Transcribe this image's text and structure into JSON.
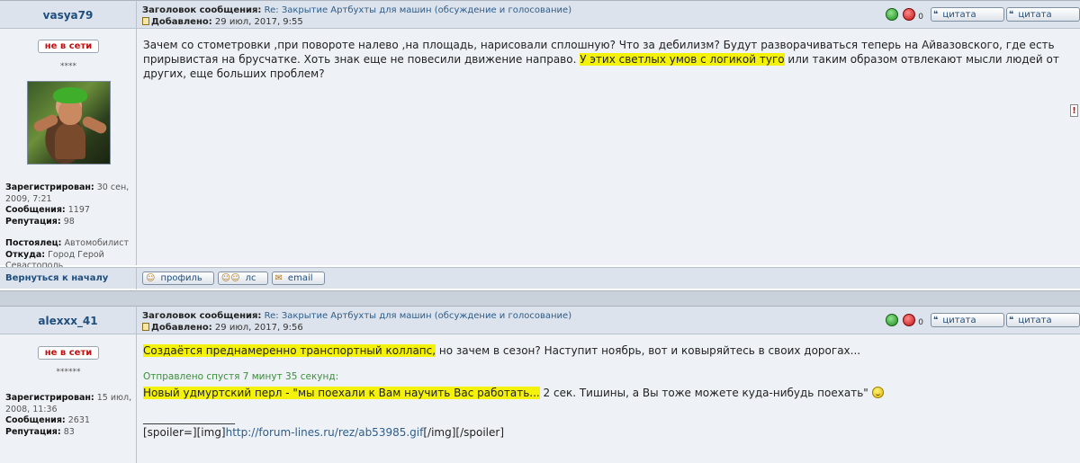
{
  "posts": [
    {
      "author": "vasya79",
      "subject_label": "Заголовок сообщения:",
      "subject": "Re: Закрытие Артбухты для машин (обсуждение и голосование)",
      "date_label": "Добавлено:",
      "date": "29 июл, 2017, 9:55",
      "karma": "0",
      "status": "не в сети",
      "stars": "****",
      "profile": {
        "registered_label": "Зарегистрирован:",
        "registered_line1": "30 сен,",
        "registered_line2": "2009, 7:21",
        "posts_label": "Сообщения:",
        "posts": "1197",
        "rep_label": "Репутация:",
        "rep": "98",
        "resident_label": "Постоялец:",
        "resident": "Автомобилист",
        "from_label": "Откуда:",
        "from_line1": "Город Герой",
        "from_line2": "Севастополь"
      },
      "message_part1": "Зачем со стометровки ,при повороте налево ,на площадь, нарисовали сплошную? Что за дебилизм? Будут разворачиваться теперь на Айвазовского, где есть прирывистая на брусчатке. Хоть знак еще не повесили движение направо. ",
      "message_highlight": "У этих светлых умов с логикой туго",
      "message_part2": " или таким образом отвлекают мысли людей от других, еще больших проблем?"
    },
    {
      "author": "alexxx_41",
      "subject_label": "Заголовок сообщения:",
      "subject": "Re: Закрытие Артбухты для машин (обсуждение и голосование)",
      "date_label": "Добавлено:",
      "date": "29 июл, 2017, 9:56",
      "karma": "0",
      "status": "не в сети",
      "stars": "******",
      "profile": {
        "registered_label": "Зарегистрирован:",
        "registered_line1": "15 июл,",
        "registered_line2": "2008, 11:36",
        "posts_label": "Сообщения:",
        "posts": "2631",
        "rep_label": "Репутация:",
        "rep": "83"
      },
      "line1_highlight": "Создаётся преднамеренно транспортный коллапс,",
      "line1_rest": " но зачем в сезон? Наступит ноябрь, вот и ковыряйтесь в своих дорогах...",
      "edit_note": "Отправлено спустя 7 минут 35 секунд:",
      "line2_highlight": "Новый удмуртский перл - \"мы поехали к Вам научить Вас работать...",
      "line2_rest": " 2 сек. Тишины, а Вы тоже можете куда-нибудь поехать\"",
      "separator": "_________________",
      "spoiler_prefix": "[spoiler=][img]",
      "spoiler_link": "http://forum-lines.ru/rez/ab53985.gif",
      "spoiler_suffix": "[/img][/spoiler]"
    }
  ],
  "buttons": {
    "quote": "цитата",
    "profile": "профиль",
    "pm": "лс",
    "email": "email",
    "back_to_top": "Вернуться к началу",
    "report": "!"
  },
  "colors": {
    "header_bg": "#dce3ec",
    "body_bg": "#eef2f6",
    "highlight": "#f4f20a",
    "author": "#1e4e7e",
    "offline": "#c01010"
  }
}
